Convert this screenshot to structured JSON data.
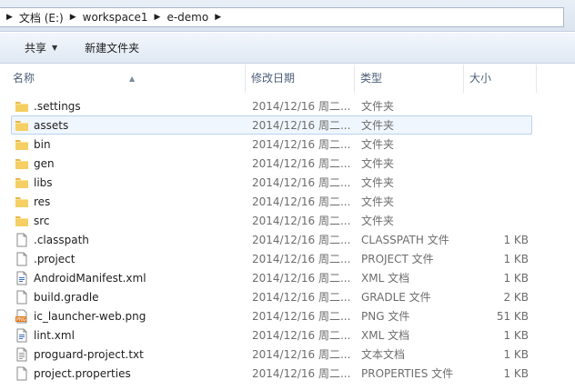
{
  "breadcrumb": [
    "文档 (E:)",
    "workspace1",
    "e-demo"
  ],
  "toolbar": {
    "share_label": "共享",
    "new_folder_label": "新建文件夹"
  },
  "columns": {
    "name": "名称",
    "date": "修改日期",
    "type": "类型",
    "size": "大小"
  },
  "files": [
    {
      "name": ".settings",
      "date": "2014/12/16 周二...",
      "type": "文件夹",
      "size": "",
      "icon": "folder-icon"
    },
    {
      "name": "assets",
      "date": "2014/12/16 周二...",
      "type": "文件夹",
      "size": "",
      "icon": "folder-icon"
    },
    {
      "name": "bin",
      "date": "2014/12/16 周二...",
      "type": "文件夹",
      "size": "",
      "icon": "folder-icon"
    },
    {
      "name": "gen",
      "date": "2014/12/16 周二...",
      "type": "文件夹",
      "size": "",
      "icon": "folder-icon"
    },
    {
      "name": "libs",
      "date": "2014/12/16 周二...",
      "type": "文件夹",
      "size": "",
      "icon": "folder-icon"
    },
    {
      "name": "res",
      "date": "2014/12/16 周二...",
      "type": "文件夹",
      "size": "",
      "icon": "folder-icon"
    },
    {
      "name": "src",
      "date": "2014/12/16 周二...",
      "type": "文件夹",
      "size": "",
      "icon": "folder-icon"
    },
    {
      "name": ".classpath",
      "date": "2014/12/16 周二...",
      "type": "CLASSPATH 文件",
      "size": "1 KB",
      "icon": "file-icon"
    },
    {
      "name": ".project",
      "date": "2014/12/16 周二...",
      "type": "PROJECT 文件",
      "size": "1 KB",
      "icon": "file-icon"
    },
    {
      "name": "AndroidManifest.xml",
      "date": "2014/12/16 周二...",
      "type": "XML 文档",
      "size": "1 KB",
      "icon": "xml-file-icon"
    },
    {
      "name": "build.gradle",
      "date": "2014/12/16 周二...",
      "type": "GRADLE 文件",
      "size": "2 KB",
      "icon": "file-icon"
    },
    {
      "name": "ic_launcher-web.png",
      "date": "2014/12/16 周二...",
      "type": "PNG 文件",
      "size": "51 KB",
      "icon": "png-file-icon"
    },
    {
      "name": "lint.xml",
      "date": "2014/12/16 周二...",
      "type": "XML 文档",
      "size": "1 KB",
      "icon": "xml-file-icon"
    },
    {
      "name": "proguard-project.txt",
      "date": "2014/12/16 周二...",
      "type": "文本文档",
      "size": "1 KB",
      "icon": "text-file-icon"
    },
    {
      "name": "project.properties",
      "date": "2014/12/16 周二...",
      "type": "PROPERTIES 文件",
      "size": "1 KB",
      "icon": "file-icon"
    }
  ],
  "hover_row": 1
}
